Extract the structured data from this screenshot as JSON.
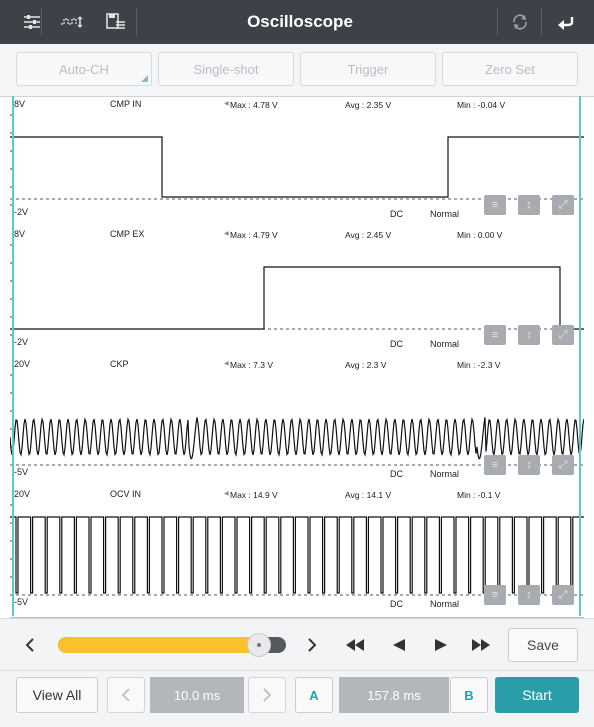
{
  "app": {
    "title": "Oscilloscope"
  },
  "toolbar": {
    "auto_ch": "Auto-CH",
    "single_shot": "Single-shot",
    "trigger": "Trigger",
    "zero_set": "Zero Set"
  },
  "channels": [
    {
      "name": "CMP IN",
      "vmax_label": "8V",
      "vmin_label": "-2V",
      "max": "Max : 4.78 V",
      "avg": "Avg : 2.35 V",
      "min": "Min : -0.04 V",
      "coupling": "DC",
      "mode": "Normal"
    },
    {
      "name": "CMP EX",
      "vmax_label": "8V",
      "vmin_label": "-2V",
      "max": "Max : 4.79 V",
      "avg": "Avg : 2.45 V",
      "min": "Min : 0.00 V",
      "coupling": "DC",
      "mode": "Normal"
    },
    {
      "name": "CKP",
      "vmax_label": "20V",
      "vmin_label": "-5V",
      "max": "Max : 7.3 V",
      "avg": "Avg : 2.3 V",
      "min": "Min : -2.3 V",
      "coupling": "DC",
      "mode": "Normal"
    },
    {
      "name": "OCV IN",
      "vmax_label": "20V",
      "vmin_label": "-5V",
      "max": "Max : 14.9 V",
      "avg": "Avg : 14.1 V",
      "min": "Min : -0.1 V",
      "coupling": "DC",
      "mode": "Normal"
    }
  ],
  "controls": {
    "save": "Save",
    "slider_fraction": 0.88
  },
  "bottom": {
    "view_all": "View All",
    "time_base": "10.0 ms",
    "cursor_a": "A",
    "cursor_delta": "157.8 ms",
    "cursor_b": "B",
    "start": "Start"
  },
  "colors": {
    "header": "#3d4249",
    "accent": "#2a9ea8",
    "slider": "#f7c22b",
    "cursor_line": "#5fc8c8"
  }
}
